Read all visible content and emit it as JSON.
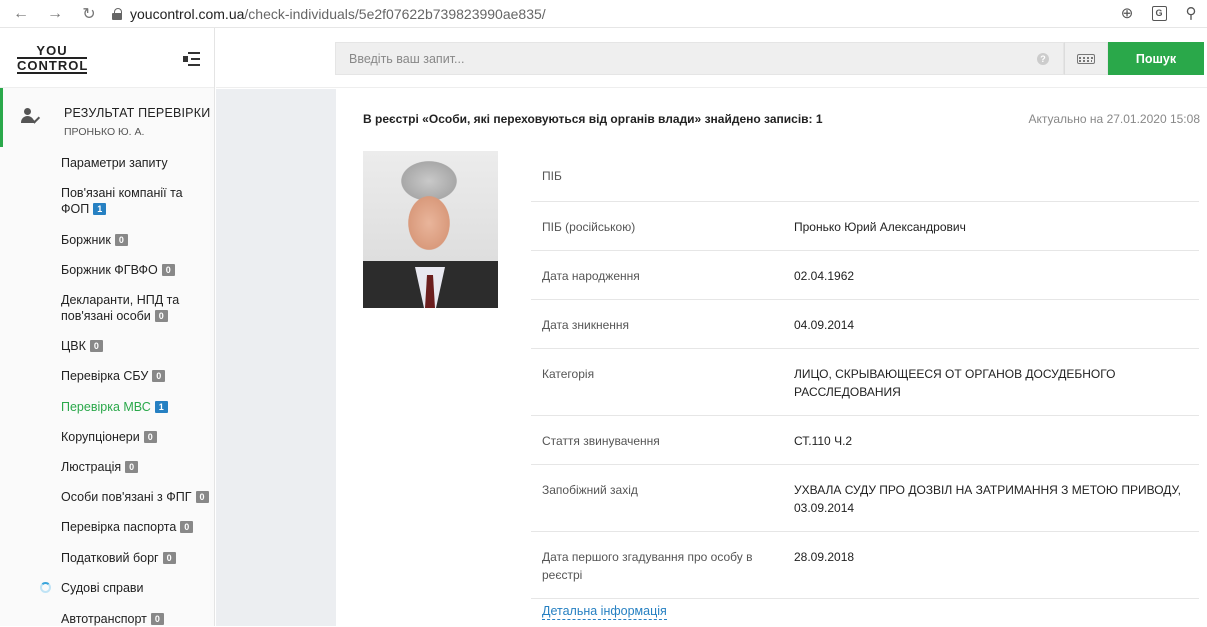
{
  "browser": {
    "url_host": "youcontrol.com.ua",
    "url_path": "/check-individuals/5e2f07622b739823990ae835/"
  },
  "logo": {
    "line1": "YOU",
    "line2": "CONTROL"
  },
  "search": {
    "placeholder": "Введіть ваш запит...",
    "help": "?",
    "button_label": "Пошук"
  },
  "sidebar": {
    "result_title": "РЕЗУЛЬТАТ ПЕРЕВІРКИ",
    "result_subtitle": "ПРОНЬКО Ю. А.",
    "items": [
      {
        "label": "Параметри запиту"
      },
      {
        "label": "Пов'язані компанії та ФОП",
        "badge": "1"
      },
      {
        "label": "Боржник",
        "badge": "0"
      },
      {
        "label": "Боржник ФГВФО",
        "badge": "0"
      },
      {
        "label": "Декларанти, НПД та пов'язані особи",
        "badge": "0"
      },
      {
        "label": "ЦВК",
        "badge": "0"
      },
      {
        "label": "Перевірка СБУ",
        "badge": "0"
      },
      {
        "label": "Перевірка МВС",
        "badge": "1"
      },
      {
        "label": "Корупціонери",
        "badge": "0"
      },
      {
        "label": "Люстрація",
        "badge": "0"
      },
      {
        "label": "Особи пов'язані з ФПГ",
        "badge": "0"
      },
      {
        "label": "Перевірка паспорта",
        "badge": "0"
      },
      {
        "label": "Податковий борг",
        "badge": "0"
      },
      {
        "label": "Судові справи"
      },
      {
        "label": "Автотранспорт",
        "badge": "0"
      }
    ]
  },
  "main": {
    "registry_title": "В реєстрі «Особи, які переховуються від органів влади» знайдено записів: 1",
    "actual_date": "Актуально на 27.01.2020 15:08",
    "details": [
      {
        "label": "ПІБ",
        "value": ""
      },
      {
        "label": "ПІБ (російською)",
        "value": "Пронько Юрий Александрович"
      },
      {
        "label": "Дата народження",
        "value": "02.04.1962"
      },
      {
        "label": "Дата зникнення",
        "value": "04.09.2014"
      },
      {
        "label": "Категорія",
        "value": "ЛИЦО, СКРЫВАЮЩЕЕСЯ ОТ ОРГАНОВ ДОСУДЕБНОГО РАССЛЕДОВАНИЯ"
      },
      {
        "label": "Стаття звинувачення",
        "value": "СТ.110 Ч.2"
      },
      {
        "label": "Запобіжний захід",
        "value": "УХВАЛА СУДУ ПРО ДОЗВІЛ НА ЗАТРИМАННЯ З МЕТОЮ ПРИВОДУ, 03.09.2014"
      },
      {
        "label": "Дата першого згадування про особу в реєстрі",
        "value": "28.09.2018"
      }
    ],
    "detail_link": "Детальна інформація"
  },
  "colors": {
    "accent_green": "#2aa84a",
    "badge_blue": "#2680c2",
    "badge_gray": "#888888"
  }
}
